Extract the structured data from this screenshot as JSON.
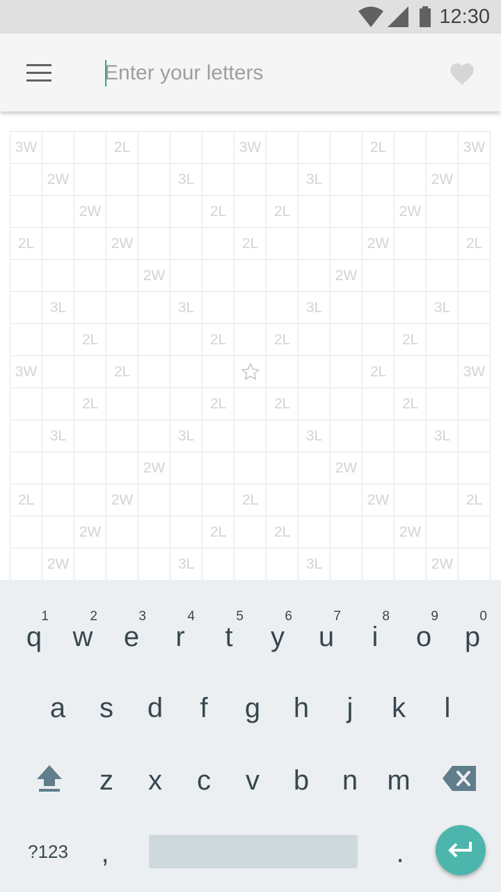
{
  "status_bar": {
    "time": "12:30",
    "icons": [
      "wifi-icon",
      "signal-icon",
      "battery-icon"
    ]
  },
  "app_bar": {
    "menu_icon": "hamburger-menu-icon",
    "search": {
      "placeholder": "Enter your letters",
      "value": ""
    },
    "favorite_icon": "heart-icon"
  },
  "board": {
    "center_icon": "star-icon",
    "rows": [
      [
        "3W",
        "",
        "",
        "2L",
        "",
        "",
        "",
        "3W",
        "",
        "",
        "",
        "2L",
        "",
        "",
        "3W"
      ],
      [
        "",
        "2W",
        "",
        "",
        "",
        "3L",
        "",
        "",
        "",
        "3L",
        "",
        "",
        "",
        "2W",
        ""
      ],
      [
        "",
        "",
        "2W",
        "",
        "",
        "",
        "2L",
        "",
        "2L",
        "",
        "",
        "",
        "2W",
        "",
        ""
      ],
      [
        "2L",
        "",
        "",
        "2W",
        "",
        "",
        "",
        "2L",
        "",
        "",
        "",
        "2W",
        "",
        "",
        "2L"
      ],
      [
        "",
        "",
        "",
        "",
        "2W",
        "",
        "",
        "",
        "",
        "",
        "2W",
        "",
        "",
        "",
        ""
      ],
      [
        "",
        "3L",
        "",
        "",
        "",
        "3L",
        "",
        "",
        "",
        "3L",
        "",
        "",
        "",
        "3L",
        ""
      ],
      [
        "",
        "",
        "2L",
        "",
        "",
        "",
        "2L",
        "",
        "2L",
        "",
        "",
        "",
        "2L",
        "",
        ""
      ],
      [
        "3W",
        "",
        "",
        "2L",
        "",
        "",
        "",
        "",
        "",
        "",
        "",
        "2L",
        "",
        "",
        "3W"
      ],
      [
        "",
        "",
        "2L",
        "",
        "",
        "",
        "2L",
        "",
        "2L",
        "",
        "",
        "",
        "2L",
        "",
        ""
      ],
      [
        "",
        "3L",
        "",
        "",
        "",
        "3L",
        "",
        "",
        "",
        "3L",
        "",
        "",
        "",
        "3L",
        ""
      ],
      [
        "",
        "",
        "",
        "",
        "2W",
        "",
        "",
        "",
        "",
        "",
        "2W",
        "",
        "",
        "",
        ""
      ],
      [
        "2L",
        "",
        "",
        "2W",
        "",
        "",
        "",
        "2L",
        "",
        "",
        "",
        "2W",
        "",
        "",
        "2L"
      ],
      [
        "",
        "",
        "2W",
        "",
        "",
        "",
        "2L",
        "",
        "2L",
        "",
        "",
        "",
        "2W",
        "",
        ""
      ],
      [
        "",
        "2W",
        "",
        "",
        "",
        "3L",
        "",
        "",
        "",
        "3L",
        "",
        "",
        "",
        "2W",
        ""
      ]
    ]
  },
  "keyboard": {
    "row1": [
      {
        "key": "q",
        "hint": "1"
      },
      {
        "key": "w",
        "hint": "2"
      },
      {
        "key": "e",
        "hint": "3"
      },
      {
        "key": "r",
        "hint": "4"
      },
      {
        "key": "t",
        "hint": "5"
      },
      {
        "key": "y",
        "hint": "6"
      },
      {
        "key": "u",
        "hint": "7"
      },
      {
        "key": "i",
        "hint": "8"
      },
      {
        "key": "o",
        "hint": "9"
      },
      {
        "key": "p",
        "hint": "0"
      }
    ],
    "row2": [
      "a",
      "s",
      "d",
      "f",
      "g",
      "h",
      "j",
      "k",
      "l"
    ],
    "row3": [
      "z",
      "x",
      "c",
      "v",
      "b",
      "n",
      "m"
    ],
    "mode_label": "?123",
    "comma": ",",
    "period": ".",
    "shift_icon": "shift-icon",
    "backspace_icon": "backspace-icon",
    "enter_icon": "enter-icon",
    "enter_color": "#4db6ac"
  }
}
